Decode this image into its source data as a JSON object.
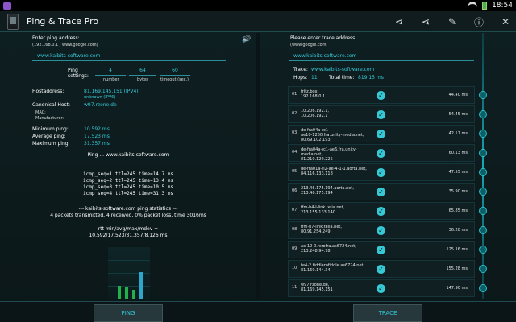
{
  "status_bar": {
    "time": "18:54"
  },
  "app": {
    "title": "Ping & Trace Pro"
  },
  "actions": [
    {
      "name": "share-icon",
      "glyph": "⋖"
    },
    {
      "name": "share-alt-icon",
      "glyph": "⋖"
    },
    {
      "name": "wrench-icon",
      "glyph": "✎"
    },
    {
      "name": "info-icon",
      "glyph": "ⓘ"
    },
    {
      "name": "close-icon",
      "glyph": "✕"
    }
  ],
  "ping": {
    "address_label": "Enter ping address:",
    "address_hint": "(192.168.0.1 / www.google.com)",
    "address_value": "www.kaibits-software.com",
    "settings_label": "Ping\nsettings:",
    "number_value": "4",
    "number_label": "number",
    "bytes_value": "64",
    "bytes_label": "bytes",
    "timeout_value": "60",
    "timeout_label": "timeout (sec.)",
    "hostaddress_label": "Hostaddress:",
    "hostaddress_value": "81.169.145.151 (IPV4)",
    "hostaddress_type": "unknown (IPV6)",
    "canonical_label": "Canonical Host:",
    "canonical_value": "w97.rzone.de",
    "mac_label": "MAC:",
    "manufacturer_label": "Manufacturer:",
    "min_label": "Minimum ping:",
    "min_value": "10.592 ms",
    "avg_label": "Average ping:",
    "avg_value": "17.523 ms",
    "max_label": "Maximum ping:",
    "max_value": "31.357 ms",
    "ping_line": "Ping ... www.kaibits-software.com",
    "results": [
      "icmp_seq=1 ttl=245 time=14.7 ms",
      "icmp_seq=2 ttl=245 time=13.4 ms",
      "icmp_seq=3 ttl=245 time=10.5 ms",
      "icmp_seq=4 ttl=245 time=31.3 ms"
    ],
    "stats_title": "--- kaibits-software.com ping statistics ---",
    "stats_line": "4 packets transmitted, 4 received, 0% packet loss, time 3016ms",
    "rtt_label": "rtt min/avg/max/mdev =",
    "rtt_value": "10.592/17.523/31.357/8.126 ms",
    "button": "PING"
  },
  "chart_data": {
    "type": "bar",
    "values": [
      14.7,
      13.4,
      10.5,
      31.3
    ],
    "ylim": [
      0,
      60
    ]
  },
  "trace": {
    "address_label": "Please enter trace address",
    "address_hint": "(www.google.com)",
    "address_value": "www.kaibits-software.com",
    "trace_label": "Trace:",
    "trace_value": "www.kaibits-software.com",
    "hops_label": "Hops:",
    "hops_value": "11",
    "total_label": "Total time:",
    "total_value": "819.15 ms",
    "hops": [
      {
        "n": "01",
        "host": "fritz.box,\n192.168.0.1",
        "time": "44.40 ms"
      },
      {
        "n": "02",
        "host": "10.206.192.1,\n10.206.192.1",
        "time": "54.45 ms"
      },
      {
        "n": "03",
        "host": "de-fra04a-rc1-\nae10-1260.fra.unity-media.net,\n80.69.102.193",
        "time": "42.17 ms"
      },
      {
        "n": "04",
        "host": "de-fra04a-rc1-ae6.fra.unity-\nmedia.net,\n81.210.129.225",
        "time": "60.13 ms"
      },
      {
        "n": "05",
        "host": "de-fra01a-ri2-ae-4-1-1.aorta.net,\n84.116.133.118",
        "time": "47.55 ms"
      },
      {
        "n": "06",
        "host": "213.46.175.194.aorta.net,\n213.46.175.194",
        "time": "35.90 ms"
      },
      {
        "n": "07",
        "host": "ffm-b4-l-link.telia.net,\n213.155.133.140",
        "time": "65.85 ms"
      },
      {
        "n": "08",
        "host": "ffm-b7-link.telia.net,\n80.91.254.249",
        "time": "36.28 ms"
      },
      {
        "n": "09",
        "host": "ae-10-0.rcrofra.as6724.net,\n213.248.94.78",
        "time": "125.16 ms"
      },
      {
        "n": "10",
        "host": "te4-2.fiddlerofiddle.as6724.net,\n81.169.144.34",
        "time": "155.28 ms"
      },
      {
        "n": "11",
        "host": "w97.rzone.de,\n81.169.145.151",
        "time": "147.90 ms"
      }
    ],
    "button": "TRACE"
  }
}
